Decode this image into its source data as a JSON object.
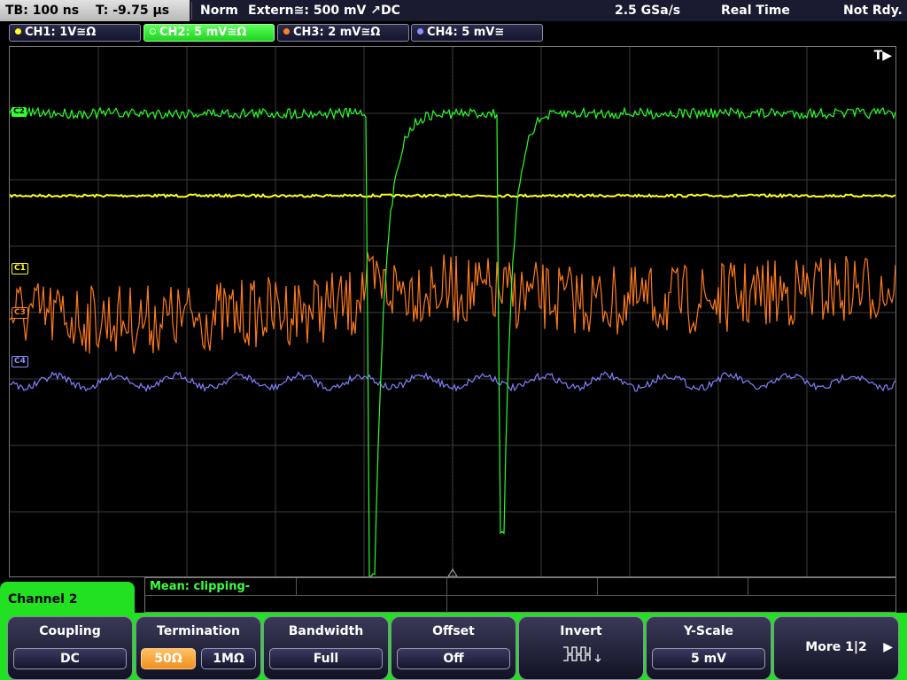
{
  "status": {
    "timebase": "TB: 100 ns",
    "trigger_time": "T: -9.75 µs",
    "trigger_mode": "Norm",
    "trigger_source": "Extern≅: 500 mV ↗DC",
    "sample_rate": "2.5 GSa/s",
    "acq_mode": "Real Time",
    "ready_state": "Not Rdy."
  },
  "channels": [
    {
      "label": "CH1: 1V≅Ω",
      "color": "#ffff20"
    },
    {
      "label": "CH2: 5 mV≅Ω",
      "color": "#30ff30",
      "active": true
    },
    {
      "label": "CH3: 2 mV≅Ω",
      "color": "#ff8020"
    },
    {
      "label": "CH4: 5 mV≅",
      "color": "#9090ff"
    }
  ],
  "markers": {
    "trigger": "T▶",
    "c1": "C1",
    "c3": "C3",
    "c4": "C4",
    "c2": "C2"
  },
  "measurement": {
    "text": "Mean: clipping-"
  },
  "channel_tab": "Channel 2",
  "softkeys": {
    "coupling": {
      "title": "Coupling",
      "value": "DC"
    },
    "termination": {
      "title": "Termination",
      "option_a": "50Ω",
      "option_b": "1MΩ"
    },
    "bandwidth": {
      "title": "Bandwidth",
      "value": "Full"
    },
    "offset": {
      "title": "Offset",
      "value": "Off"
    },
    "invert": {
      "title": "Invert"
    },
    "yscale": {
      "title": "Y-Scale",
      "value": "5 mV"
    },
    "more": {
      "title": "More 1|2",
      "arrow": "▶"
    }
  }
}
